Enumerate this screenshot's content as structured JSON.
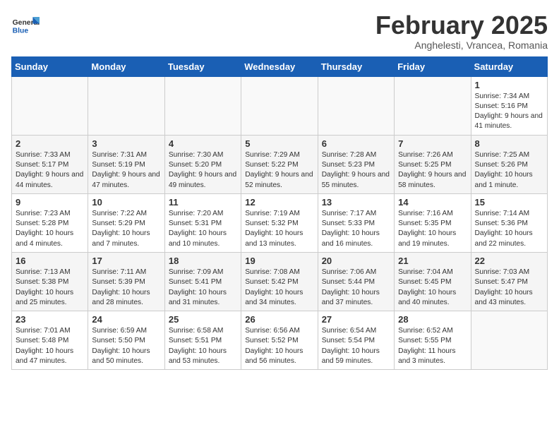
{
  "header": {
    "logo_general": "General",
    "logo_blue": "Blue",
    "month_title": "February 2025",
    "subtitle": "Anghelesti, Vrancea, Romania"
  },
  "weekdays": [
    "Sunday",
    "Monday",
    "Tuesday",
    "Wednesday",
    "Thursday",
    "Friday",
    "Saturday"
  ],
  "weeks": [
    {
      "shade": false,
      "days": [
        {
          "num": "",
          "info": ""
        },
        {
          "num": "",
          "info": ""
        },
        {
          "num": "",
          "info": ""
        },
        {
          "num": "",
          "info": ""
        },
        {
          "num": "",
          "info": ""
        },
        {
          "num": "",
          "info": ""
        },
        {
          "num": "1",
          "info": "Sunrise: 7:34 AM\nSunset: 5:16 PM\nDaylight: 9 hours and 41 minutes."
        }
      ]
    },
    {
      "shade": true,
      "days": [
        {
          "num": "2",
          "info": "Sunrise: 7:33 AM\nSunset: 5:17 PM\nDaylight: 9 hours and 44 minutes."
        },
        {
          "num": "3",
          "info": "Sunrise: 7:31 AM\nSunset: 5:19 PM\nDaylight: 9 hours and 47 minutes."
        },
        {
          "num": "4",
          "info": "Sunrise: 7:30 AM\nSunset: 5:20 PM\nDaylight: 9 hours and 49 minutes."
        },
        {
          "num": "5",
          "info": "Sunrise: 7:29 AM\nSunset: 5:22 PM\nDaylight: 9 hours and 52 minutes."
        },
        {
          "num": "6",
          "info": "Sunrise: 7:28 AM\nSunset: 5:23 PM\nDaylight: 9 hours and 55 minutes."
        },
        {
          "num": "7",
          "info": "Sunrise: 7:26 AM\nSunset: 5:25 PM\nDaylight: 9 hours and 58 minutes."
        },
        {
          "num": "8",
          "info": "Sunrise: 7:25 AM\nSunset: 5:26 PM\nDaylight: 10 hours and 1 minute."
        }
      ]
    },
    {
      "shade": false,
      "days": [
        {
          "num": "9",
          "info": "Sunrise: 7:23 AM\nSunset: 5:28 PM\nDaylight: 10 hours and 4 minutes."
        },
        {
          "num": "10",
          "info": "Sunrise: 7:22 AM\nSunset: 5:29 PM\nDaylight: 10 hours and 7 minutes."
        },
        {
          "num": "11",
          "info": "Sunrise: 7:20 AM\nSunset: 5:31 PM\nDaylight: 10 hours and 10 minutes."
        },
        {
          "num": "12",
          "info": "Sunrise: 7:19 AM\nSunset: 5:32 PM\nDaylight: 10 hours and 13 minutes."
        },
        {
          "num": "13",
          "info": "Sunrise: 7:17 AM\nSunset: 5:33 PM\nDaylight: 10 hours and 16 minutes."
        },
        {
          "num": "14",
          "info": "Sunrise: 7:16 AM\nSunset: 5:35 PM\nDaylight: 10 hours and 19 minutes."
        },
        {
          "num": "15",
          "info": "Sunrise: 7:14 AM\nSunset: 5:36 PM\nDaylight: 10 hours and 22 minutes."
        }
      ]
    },
    {
      "shade": true,
      "days": [
        {
          "num": "16",
          "info": "Sunrise: 7:13 AM\nSunset: 5:38 PM\nDaylight: 10 hours and 25 minutes."
        },
        {
          "num": "17",
          "info": "Sunrise: 7:11 AM\nSunset: 5:39 PM\nDaylight: 10 hours and 28 minutes."
        },
        {
          "num": "18",
          "info": "Sunrise: 7:09 AM\nSunset: 5:41 PM\nDaylight: 10 hours and 31 minutes."
        },
        {
          "num": "19",
          "info": "Sunrise: 7:08 AM\nSunset: 5:42 PM\nDaylight: 10 hours and 34 minutes."
        },
        {
          "num": "20",
          "info": "Sunrise: 7:06 AM\nSunset: 5:44 PM\nDaylight: 10 hours and 37 minutes."
        },
        {
          "num": "21",
          "info": "Sunrise: 7:04 AM\nSunset: 5:45 PM\nDaylight: 10 hours and 40 minutes."
        },
        {
          "num": "22",
          "info": "Sunrise: 7:03 AM\nSunset: 5:47 PM\nDaylight: 10 hours and 43 minutes."
        }
      ]
    },
    {
      "shade": false,
      "days": [
        {
          "num": "23",
          "info": "Sunrise: 7:01 AM\nSunset: 5:48 PM\nDaylight: 10 hours and 47 minutes."
        },
        {
          "num": "24",
          "info": "Sunrise: 6:59 AM\nSunset: 5:50 PM\nDaylight: 10 hours and 50 minutes."
        },
        {
          "num": "25",
          "info": "Sunrise: 6:58 AM\nSunset: 5:51 PM\nDaylight: 10 hours and 53 minutes."
        },
        {
          "num": "26",
          "info": "Sunrise: 6:56 AM\nSunset: 5:52 PM\nDaylight: 10 hours and 56 minutes."
        },
        {
          "num": "27",
          "info": "Sunrise: 6:54 AM\nSunset: 5:54 PM\nDaylight: 10 hours and 59 minutes."
        },
        {
          "num": "28",
          "info": "Sunrise: 6:52 AM\nSunset: 5:55 PM\nDaylight: 11 hours and 3 minutes."
        },
        {
          "num": "",
          "info": ""
        }
      ]
    }
  ]
}
